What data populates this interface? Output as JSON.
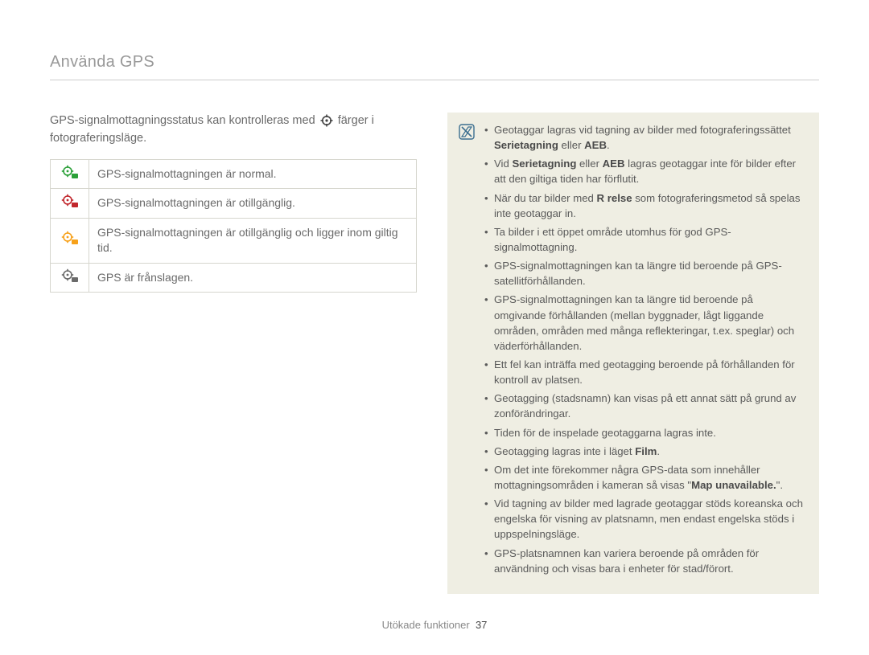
{
  "header": {
    "title": "Använda GPS"
  },
  "intro": {
    "before_icon": "GPS-signalmottagningsstatus kan kontrolleras med ",
    "after_icon": " färger i fotograferingsläge."
  },
  "status_rows": [
    {
      "icon_color": "#2aa038",
      "text": "GPS-signalmottagningen är normal."
    },
    {
      "icon_color": "#c1272d",
      "text": "GPS-signalmottagningen är otillgänglig."
    },
    {
      "icon_color": "#f7a11a",
      "text": "GPS-signalmottagningen är otillgänglig och ligger inom giltig tid."
    },
    {
      "icon_color": "#6a6a6a",
      "text": "GPS är frånslagen."
    }
  ],
  "notes": [
    {
      "html": "Geotaggar lagras vid tagning av bilder med fotograferingssättet <span class=\"bold\">Serietagning</span> eller <span class=\"bold\">AEB</span>."
    },
    {
      "html": "Vid <span class=\"bold\">Serietagning</span> eller <span class=\"bold\">AEB</span> lagras geotaggar inte för bilder efter att den giltiga tiden har förflutit."
    },
    {
      "html": "När du tar bilder med <span class=\"bold\">R relse</span> som fotograferingsmetod så spelas inte geotaggar in."
    },
    {
      "html": "Ta bilder i ett öppet område utomhus för god GPS-signalmottagning."
    },
    {
      "html": "GPS-signalmottagningen kan ta längre tid beroende på GPS-satellitförhållanden."
    },
    {
      "html": "GPS-signalmottagningen kan ta längre tid beroende på omgivande förhållanden (mellan byggnader, lågt liggande områden, områden med många reflekteringar, t.ex. speglar) och väderförhållanden."
    },
    {
      "html": "Ett fel kan inträffa med geotagging beroende på förhållanden för kontroll av platsen."
    },
    {
      "html": "Geotagging (stadsnamn) kan visas på ett annat sätt på grund av zonförändringar."
    },
    {
      "html": "Tiden för de inspelade geotaggarna lagras inte."
    },
    {
      "html": "Geotagging lagras inte i läget <span class=\"bold\">Film</span>."
    },
    {
      "html": "Om det inte förekommer några GPS-data som innehåller mottagningsområden i kameran så visas \"<span class=\"bold\">Map unavailable.</span>\"."
    },
    {
      "html": "Vid tagning av bilder med lagrade geotaggar stöds koreanska och engelska för visning av platsnamn, men endast engelska stöds i uppspelningsläge."
    },
    {
      "html": "GPS-platsnamnen kan variera beroende på områden för användning och visas bara i enheter för stad/förort."
    }
  ],
  "footer": {
    "label": "Utökade funktioner",
    "page": "37"
  }
}
